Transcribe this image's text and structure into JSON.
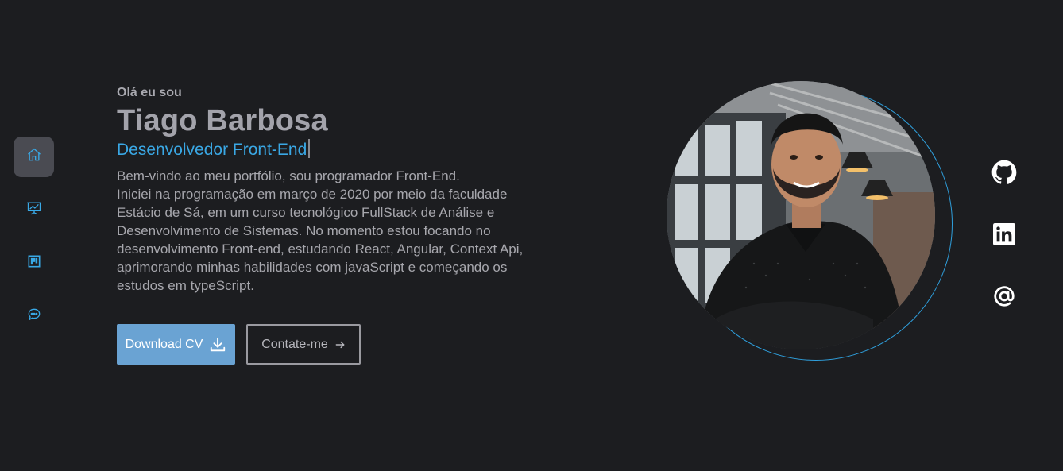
{
  "nav": {
    "items": [
      {
        "id": "home",
        "icon": "home-icon",
        "active": true
      },
      {
        "id": "projects",
        "icon": "presentation-icon",
        "active": false
      },
      {
        "id": "portfolio",
        "icon": "kanban-icon",
        "active": false
      },
      {
        "id": "contact",
        "icon": "chat-icon",
        "active": false
      }
    ]
  },
  "hero": {
    "greeting": "Olá eu sou",
    "name": "Tiago Barbosa",
    "role": "Desenvolvedor Front-End",
    "bio": [
      "Bem-vindo ao meu portfólio, sou programador Front-End.",
      "Iniciei na programação em março de 2020 por meio da faculdade",
      "Estácio de Sá, em um curso tecnológico FullStack de Análise e",
      "Desenvolvimento de Sistemas. No momento estou focando no",
      "desenvolvimento Front-end, estudando React, Angular, Context Api,",
      "aprimorando minhas habilidades com javaScript e começando os",
      "estudos em typeScript."
    ]
  },
  "buttons": {
    "download_label": "Download CV",
    "contact_label": "Contate-me"
  },
  "social": {
    "items": [
      {
        "id": "github",
        "icon": "github-icon"
      },
      {
        "id": "linkedin",
        "icon": "linkedin-icon"
      },
      {
        "id": "email",
        "icon": "at-sign-icon"
      }
    ]
  },
  "colors": {
    "background": "#1c1d20",
    "accent": "#3aa8e5",
    "nav_active": "#4a4b52",
    "download_button": "#6aa3d3",
    "text_muted": "#a7a7ad"
  }
}
